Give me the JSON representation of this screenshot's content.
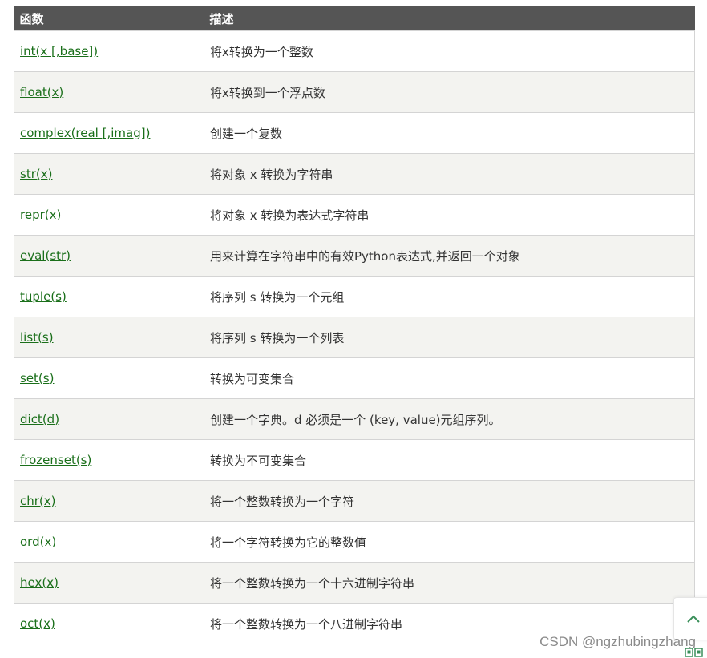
{
  "table": {
    "headers": [
      "函数",
      "描述"
    ],
    "rows": [
      {
        "fn": "int(x [,base])",
        "desc": "将x转换为一个整数"
      },
      {
        "fn": "float(x)",
        "desc": "将x转换到一个浮点数"
      },
      {
        "fn": "complex(real [,imag])",
        "desc": "创建一个复数"
      },
      {
        "fn": "str(x)",
        "desc": "将对象 x 转换为字符串"
      },
      {
        "fn": "repr(x)",
        "desc": "将对象 x 转换为表达式字符串"
      },
      {
        "fn": "eval(str)",
        "desc": "用来计算在字符串中的有效Python表达式,并返回一个对象"
      },
      {
        "fn": "tuple(s)",
        "desc": "将序列 s 转换为一个元组"
      },
      {
        "fn": "list(s)",
        "desc": "将序列 s 转换为一个列表"
      },
      {
        "fn": "set(s)",
        "desc": "转换为可变集合"
      },
      {
        "fn": "dict(d)",
        "desc": "创建一个字典。d 必须是一个 (key, value)元组序列。"
      },
      {
        "fn": "frozenset(s)",
        "desc": "转换为不可变集合"
      },
      {
        "fn": "chr(x)",
        "desc": "将一个整数转换为一个字符"
      },
      {
        "fn": "ord(x)",
        "desc": "将一个字符转换为它的整数值"
      },
      {
        "fn": "hex(x)",
        "desc": "将一个整数转换为一个十六进制字符串"
      },
      {
        "fn": "oct(x)",
        "desc": "将一个整数转换为一个八进制字符串"
      }
    ]
  },
  "watermark": "CSDN @ngzhubingzhang",
  "icons": {
    "back_to_top": "chevron-up-icon",
    "corner": "grid-icon"
  },
  "colors": {
    "header_bg": "#555555",
    "link": "#1a6f1a",
    "alt_row": "#f3f3f0"
  }
}
